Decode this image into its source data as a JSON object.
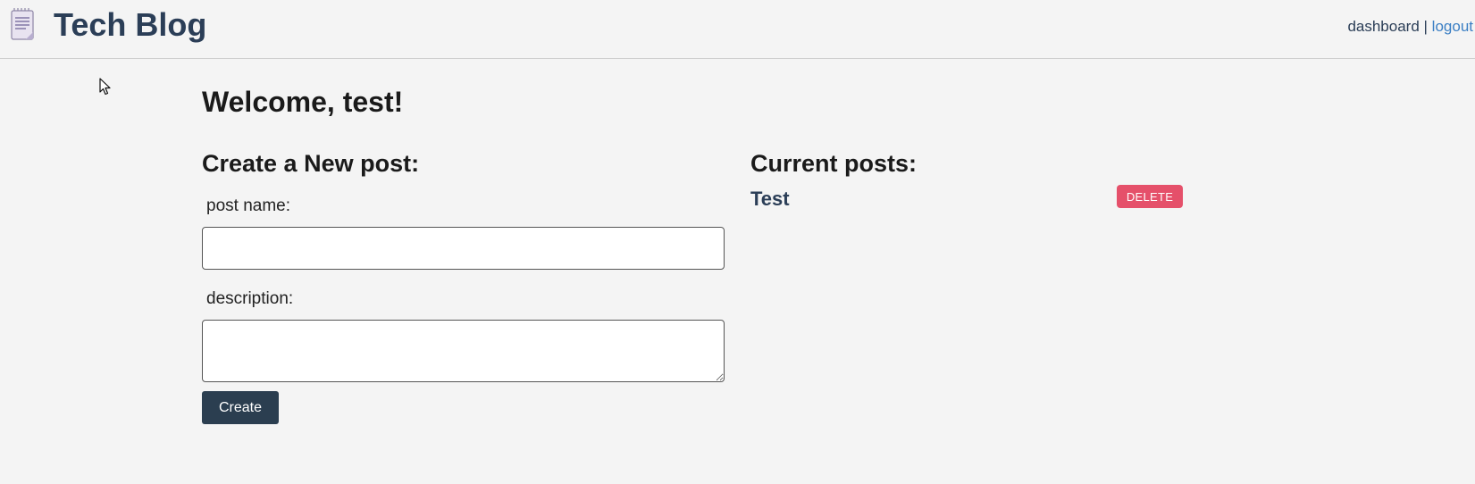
{
  "header": {
    "brand": "Tech Blog",
    "logo_icon": "notepad-icon",
    "nav": {
      "dashboard": "dashboard",
      "separator": "|",
      "logout": "logout"
    }
  },
  "main": {
    "welcome": "Welcome, test!",
    "create": {
      "title": "Create a New post:",
      "name_label": "post name:",
      "name_value": "",
      "description_label": "description:",
      "description_value": "",
      "submit_label": "Create"
    },
    "current": {
      "title": "Current posts:",
      "posts": [
        {
          "title": "Test",
          "delete_label": "DELETE"
        }
      ]
    }
  },
  "colors": {
    "brand": "#2b3e57",
    "button": "#2b3e50",
    "delete": "#e5506a",
    "link": "#3b7fc4",
    "background": "#f4f4f4"
  }
}
